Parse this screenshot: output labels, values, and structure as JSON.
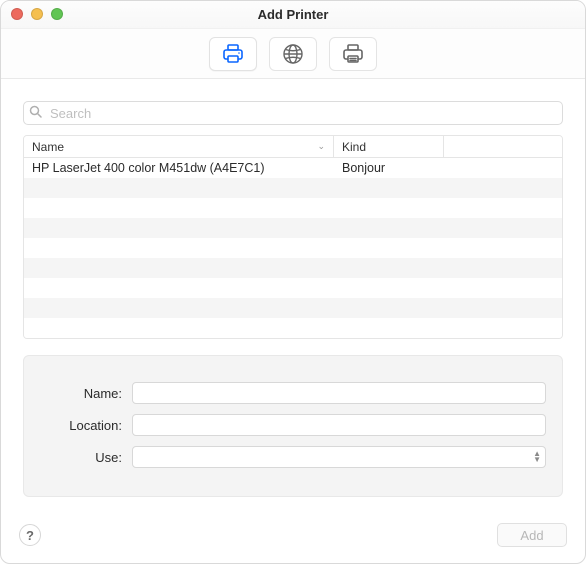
{
  "window": {
    "title": "Add Printer"
  },
  "toolbar": {
    "active_index": 0,
    "items": [
      {
        "name": "default-tab",
        "icon": "printer-icon"
      },
      {
        "name": "ip-tab",
        "icon": "globe-icon"
      },
      {
        "name": "windows-tab",
        "icon": "advanced-printer-icon"
      }
    ]
  },
  "search": {
    "placeholder": "Search",
    "value": ""
  },
  "table": {
    "columns": {
      "name": "Name",
      "kind": "Kind"
    },
    "rows": [
      {
        "name": "HP LaserJet 400 color M451dw (A4E7C1)",
        "kind": "Bonjour"
      }
    ],
    "empty_row_count": 8
  },
  "form": {
    "name_label": "Name:",
    "location_label": "Location:",
    "use_label": "Use:",
    "name_value": "",
    "location_value": "",
    "use_value": ""
  },
  "footer": {
    "help_label": "?",
    "add_label": "Add",
    "add_enabled": false
  }
}
